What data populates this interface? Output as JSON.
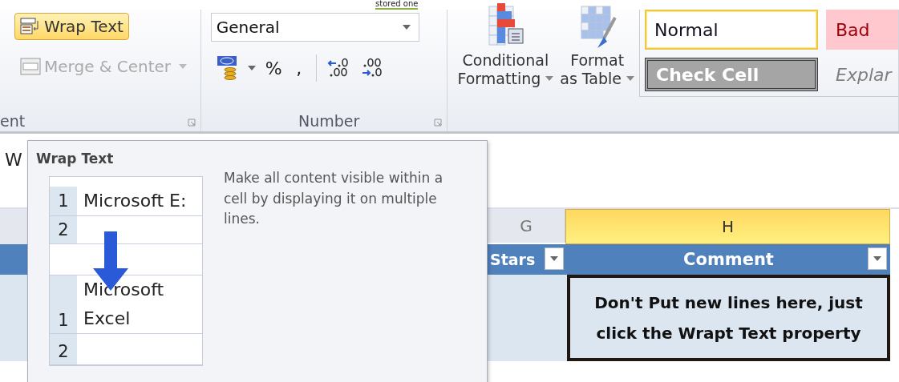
{
  "link": "stored one",
  "ribbon": {
    "alignment": {
      "label": "ent",
      "buttons": [
        {
          "label": "Wrap Text",
          "kind": "wrap",
          "selected": true,
          "disabled": false
        },
        {
          "label": "Merge & Center",
          "kind": "merge",
          "selected": false,
          "disabled": true
        }
      ]
    },
    "number": {
      "label": "Number",
      "format": "General",
      "symbols": [
        "%",
        ","
      ]
    },
    "styles": {
      "buttons": [
        {
          "lines": [
            "Conditional",
            "Formatting"
          ],
          "kind": "conditional"
        },
        {
          "lines": [
            "Format",
            "as Table"
          ],
          "kind": "table"
        }
      ],
      "gallery": [
        {
          "label": "Normal",
          "kind": "normal",
          "selected": true
        },
        {
          "label": "Bad",
          "kind": "bad",
          "selected": false
        },
        {
          "label": "Check Cell",
          "kind": "check",
          "selected": false
        },
        {
          "label": "Explar",
          "kind": "explanatory",
          "selected": false
        }
      ]
    }
  },
  "sheet": {
    "cell_text": "W",
    "columns": [
      {
        "letter": "G",
        "header": "Stars",
        "selected": false
      },
      {
        "letter": "H",
        "header": "Comment",
        "selected": true
      }
    ],
    "selected_cell": "Don't Put new lines here, just click the Wrapt Text property"
  },
  "tooltip": {
    "title": "Wrap Text",
    "description": "Make all content visible within a cell by displaying it on multiple lines.",
    "before": [
      {
        "number": "1",
        "lines": [
          "Microsoft E:"
        ]
      },
      {
        "number": "2"
      }
    ],
    "after": [
      {
        "number": "1",
        "lines": [
          "Microsoft",
          "Excel"
        ]
      },
      {
        "number": "2"
      }
    ]
  }
}
